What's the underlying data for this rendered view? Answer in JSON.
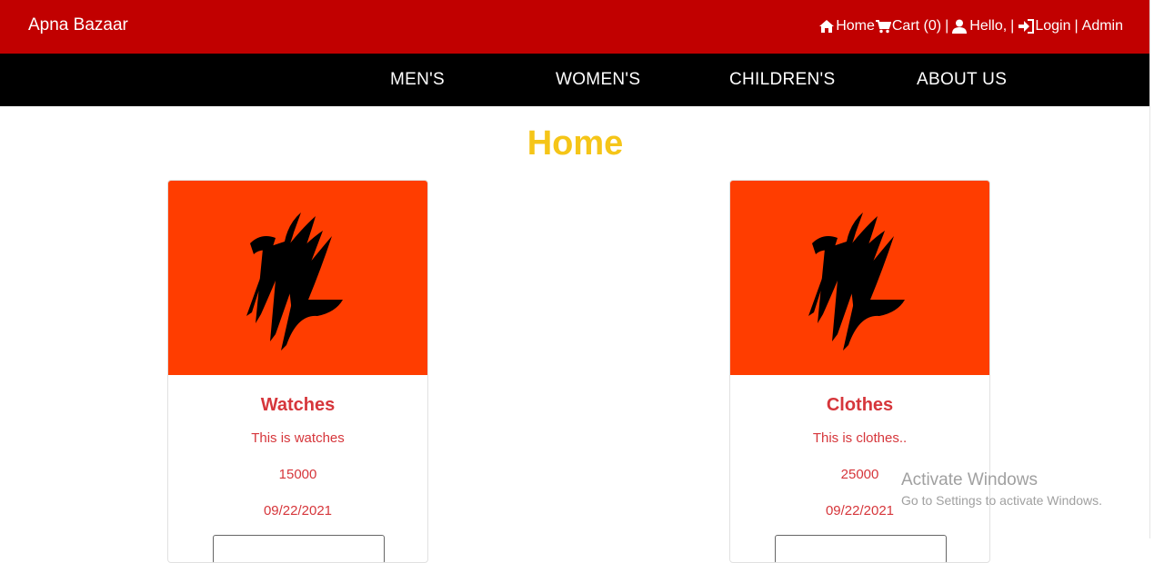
{
  "header": {
    "brand": "Apna Bazaar",
    "nav": {
      "home": "Home",
      "cart": "Cart (0)",
      "sep1": "|",
      "hello": "Hello,",
      "sep2": "|",
      "login": "Login",
      "sep3": "|",
      "admin": "Admin"
    },
    "icons": [
      "home-icon",
      "cart-icon",
      "user-icon",
      "login-icon"
    ]
  },
  "menu": {
    "items": [
      {
        "label": "MEN'S"
      },
      {
        "label": "WOMEN'S"
      },
      {
        "label": "CHILDREN'S"
      },
      {
        "label": "ABOUT US"
      }
    ]
  },
  "page": {
    "title": "Home"
  },
  "products": [
    {
      "name": "Watches",
      "description": "This is watches",
      "price": "15000",
      "date": "09/22/2021"
    },
    {
      "name": "Clothes",
      "description": "This is clothes..",
      "price": "25000",
      "date": "09/22/2021"
    }
  ],
  "watermark": {
    "line1": "Activate Windows",
    "line2": "Go to Settings to activate Windows."
  },
  "colors": {
    "header_bg": "#c10000",
    "menu_bg": "#000000",
    "title": "#f5c518",
    "card_image_bg": "#ff3d00",
    "card_text": "#d6363b"
  }
}
